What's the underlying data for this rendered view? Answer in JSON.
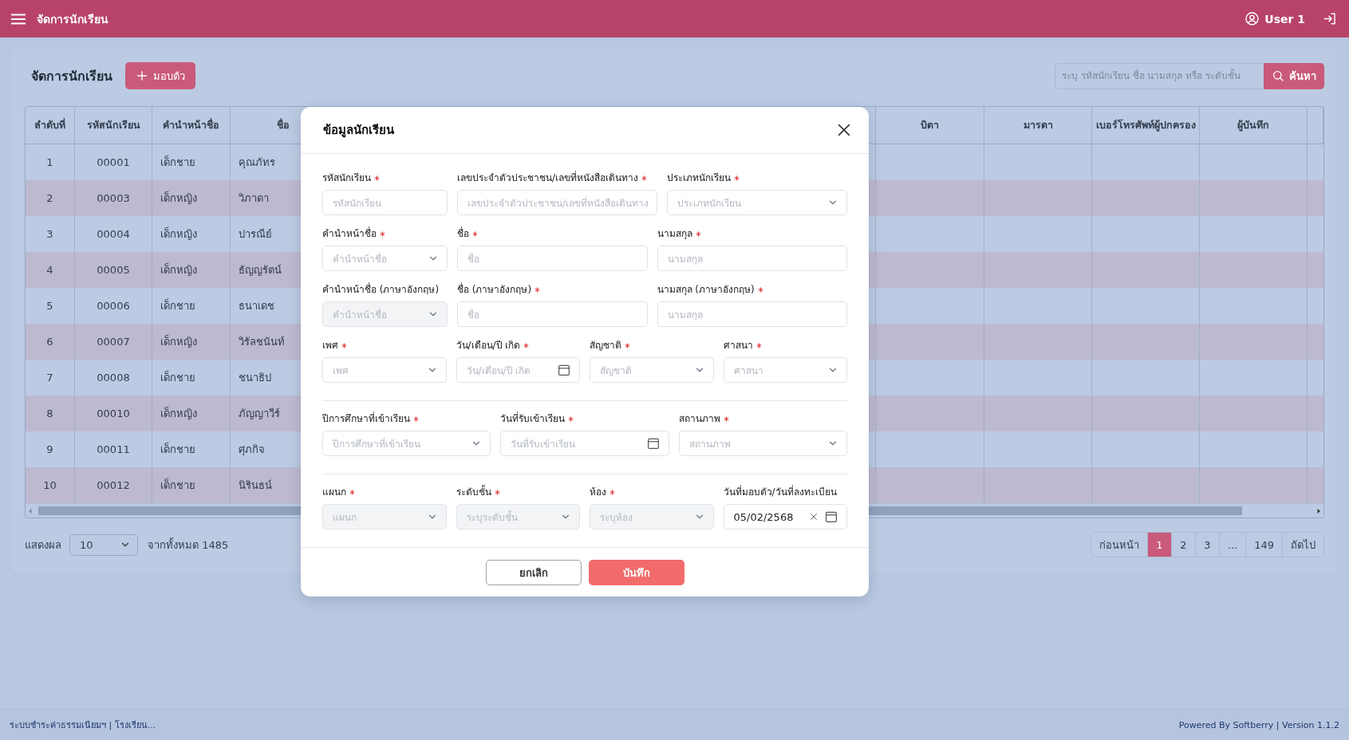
{
  "app_bar": {
    "title": "จัดการนักเรียน",
    "user": "User 1"
  },
  "page": {
    "title": "จัดการนักเรียน",
    "add_button": "มอบตัว",
    "search": {
      "placeholder": "ระบุ รหัสนักเรียน ชื่อ นามสกุล หรือ ระดับชั้น",
      "button": "ค้นหา"
    }
  },
  "table": {
    "columns": [
      "ลำดับที่",
      "รหัสนักเรียน",
      "คำนำหน้าชื่อ",
      "ชื่อ",
      "บิดา",
      "มารดา",
      "เบอร์โทรศัพท์ผู้ปกครอง",
      "ผู้บันทึก"
    ],
    "rows": [
      [
        "1",
        "00001",
        "เด็กชาย",
        "คุณภัทร"
      ],
      [
        "2",
        "00003",
        "เด็กหญิง",
        "วิภาดา"
      ],
      [
        "3",
        "00004",
        "เด็กหญิง",
        "ปารณีย์"
      ],
      [
        "4",
        "00005",
        "เด็กหญิง",
        "ธัญญรัตน์"
      ],
      [
        "5",
        "00006",
        "เด็กชาย",
        "ธนาเดช"
      ],
      [
        "6",
        "00007",
        "เด็กหญิง",
        "วิรัลชนันท์"
      ],
      [
        "7",
        "00008",
        "เด็กชาย",
        "ชนาธิป"
      ],
      [
        "8",
        "00010",
        "เด็กหญิง",
        "ภัญญาวีร์"
      ],
      [
        "9",
        "00011",
        "เด็กชาย",
        "ศุภกิจ"
      ],
      [
        "10",
        "00012",
        "เด็กชาย",
        "นิรินธน์"
      ]
    ]
  },
  "page_size": {
    "label": "แสดงผล",
    "value": "10",
    "total": "จากทั้งหมด 1485"
  },
  "pagination": [
    {
      "label": "ก่อนหน้า",
      "selected": false
    },
    {
      "label": "1",
      "selected": true
    },
    {
      "label": "2",
      "selected": false
    },
    {
      "label": "3",
      "selected": false
    },
    {
      "label": "...",
      "selected": false
    },
    {
      "label": "149",
      "selected": false
    },
    {
      "label": "ถัดไป",
      "selected": false
    }
  ],
  "modal": {
    "title": "ข้อมูลนักเรียน",
    "sections": [
      {
        "kind": "mixed",
        "rows": [
          [
            {
              "label": "รหัสนักเรียน",
              "required": true,
              "kind": "text",
              "placeholder": "รหัสนักเรียน",
              "disabled": false
            },
            {
              "label": "เลขประจำตัวประชาชน/เลขที่หนังสือเดินทาง",
              "required": true,
              "kind": "text",
              "placeholder": "เลขประจำตัวประชาชน/เลขที่หนังสือเดินทาง",
              "disabled": false
            },
            {
              "label": "ประเภทนักเรียน",
              "required": true,
              "kind": "select",
              "placeholder": "ประเภทนักเรียน",
              "disabled": false
            }
          ],
          [
            {
              "label": "คำนำหน้าชื่อ",
              "required": true,
              "kind": "select",
              "placeholder": "คำนำหน้าชื่อ",
              "disabled": false
            },
            {
              "label": "ชื่อ",
              "required": true,
              "kind": "text",
              "placeholder": "ชื่อ",
              "disabled": false
            },
            {
              "label": "นามสกุล",
              "required": true,
              "kind": "text",
              "placeholder": "นามสกุล",
              "disabled": false
            }
          ],
          [
            {
              "label": "คำนำหน้าชื่อ (ภาษาอังกฤษ)",
              "required": false,
              "kind": "select",
              "placeholder": "คำนำหน้าชื่อ",
              "disabled": true
            },
            {
              "label": "ชื่อ (ภาษาอังกฤษ)",
              "required": true,
              "kind": "text",
              "placeholder": "ชื่อ",
              "disabled": false
            },
            {
              "label": "นามสกุล (ภาษาอังกฤษ)",
              "required": true,
              "kind": "text",
              "placeholder": "นามสกุล",
              "disabled": false
            }
          ],
          [
            {
              "label": "เพศ",
              "required": true,
              "kind": "select",
              "placeholder": "เพศ",
              "disabled": false
            },
            {
              "label": "วัน/เดือน/ปี เกิด",
              "required": true,
              "kind": "date",
              "placeholder": "วัน/เดือน/ปี เกิด",
              "disabled": false
            },
            {
              "label": "สัญชาติ",
              "required": true,
              "kind": "select",
              "placeholder": "สัญชาติ",
              "disabled": false
            },
            {
              "label": "ศาสนา",
              "required": true,
              "kind": "select",
              "placeholder": "ศาสนา",
              "disabled": false
            }
          ]
        ]
      },
      {
        "kind": "even",
        "rows": [
          [
            {
              "label": "ปีการศึกษาที่เข้าเรียน",
              "required": true,
              "kind": "select",
              "placeholder": "ปีการศึกษาที่เข้าเรียน",
              "disabled": false
            },
            {
              "label": "วันที่รับเข้าเรียน",
              "required": true,
              "kind": "date",
              "placeholder": "วันที่รับเข้าเรียน",
              "disabled": false
            },
            {
              "label": "สถานภาพ",
              "required": true,
              "kind": "select",
              "placeholder": "สถานภาพ",
              "disabled": false
            }
          ]
        ]
      },
      {
        "kind": "even",
        "rows": [
          [
            {
              "label": "แผนก",
              "required": true,
              "kind": "select",
              "placeholder": "แผนก",
              "disabled": true
            },
            {
              "label": "ระดับชั้น",
              "required": true,
              "kind": "select",
              "placeholder": "ระบุระดับชั้น",
              "disabled": true
            },
            {
              "label": "ห้อง",
              "required": true,
              "kind": "select",
              "placeholder": "ระบุห้อง",
              "disabled": true
            },
            {
              "label": "วันที่มอบตัว/วันที่ลงทะเบียน",
              "required": false,
              "kind": "date",
              "value": "05/02/2568",
              "disabled": false
            }
          ]
        ]
      }
    ],
    "cancel": "ยกเลิก",
    "save": "บันทึก"
  },
  "footer": {
    "left": "ระบบชำระค่าธรรมเนียมฯ | โรงเรียน...",
    "right": "Powered By Softberry | Version 1.1.2"
  }
}
